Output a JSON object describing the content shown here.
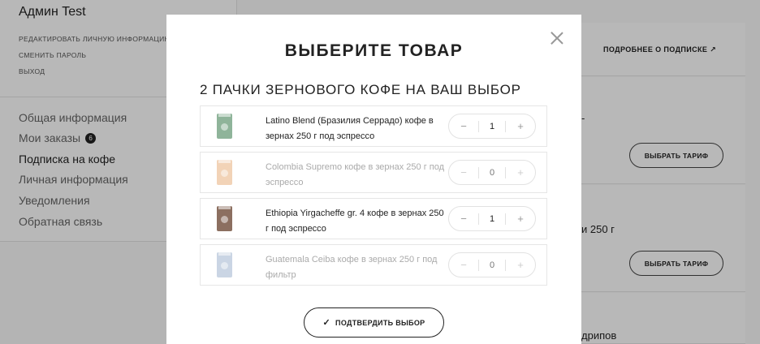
{
  "sidebar": {
    "user_name": "Админ Test",
    "account_links": [
      "РЕДАКТИРОВАТЬ ЛИЧНУЮ ИНФОРМАЦИЮ",
      "СМЕНИТЬ ПАРОЛЬ",
      "ВЫХОД"
    ],
    "nav": [
      {
        "label": "Общая информация"
      },
      {
        "label": "Мои заказы",
        "badge": "6"
      },
      {
        "label": "Подписка на кофе",
        "active": true
      },
      {
        "label": "Личная информация"
      },
      {
        "label": "Уведомления"
      },
      {
        "label": "Обратная связь"
      }
    ]
  },
  "background": {
    "more_link": "ПОДРОБНЕЕ О ПОДПИСКЕ",
    "choose_tariff_1": "ВЫБРАТЬ ТАРИФ",
    "choose_tariff_2": "ВЫБРАТЬ ТАРИФ",
    "text_250": "и 250 г",
    "text_drips": "дрипов",
    "dash": "-"
  },
  "modal": {
    "title": "ВЫБЕРИТЕ ТОВАР",
    "subtitle": "2 ПАЧКИ ЗЕРНОВОГО КОФЕ НА ВАШ ВЫБОР",
    "products": [
      {
        "name": "Latino Blend (Бразилия Серрадо) кофе в зернах 250 г под эспрессо",
        "qty": "1",
        "color": "#8fb49a",
        "disabled": false
      },
      {
        "name": "Colombia Supremo кофе в зернах 250 г под эспрессо",
        "qty": "0",
        "color": "#e8b07e",
        "disabled": true
      },
      {
        "name": "Ethiopia Yirgacheffe gr. 4 кофе в зернах 250 г под эспрессо",
        "qty": "1",
        "color": "#8c6f60",
        "disabled": false
      },
      {
        "name": "Guatemala Ceiba кофе в зернах 250 г под фильтр",
        "qty": "0",
        "color": "#9fb4cf",
        "disabled": true
      }
    ],
    "minus": "−",
    "plus": "+",
    "confirm_label": "ПОДТВЕРДИТЬ ВЫБОР",
    "confirm_icon": "✓"
  }
}
